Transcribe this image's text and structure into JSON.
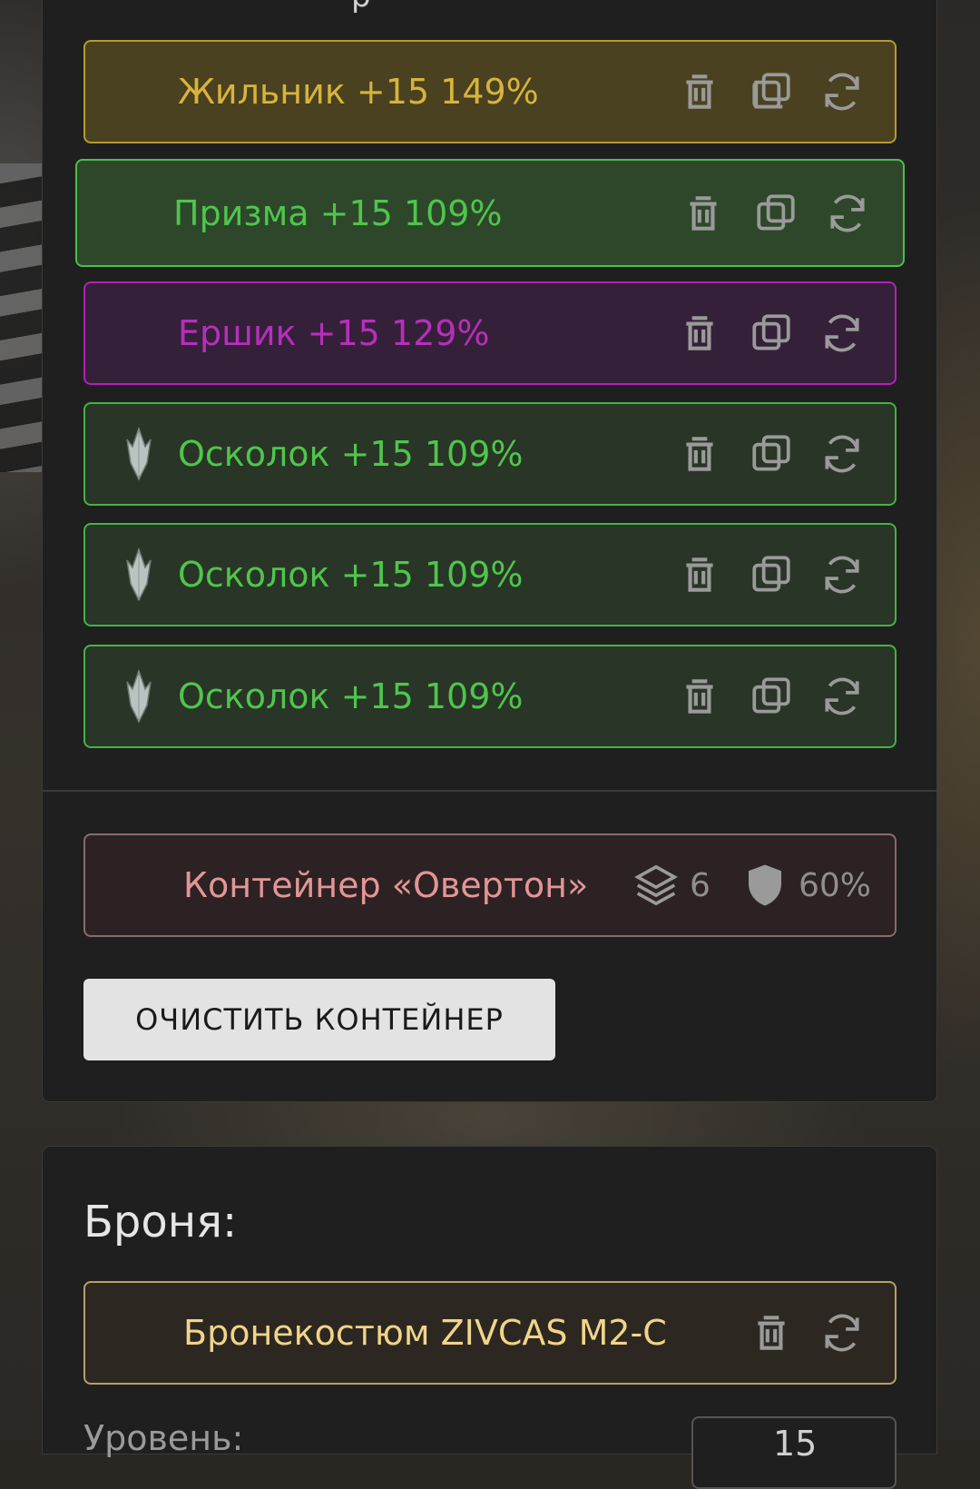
{
  "top_panel_partial_heading": "р",
  "modules": [
    {
      "label": "Жильник +15 149%",
      "color": "yellow",
      "has_gem": false
    },
    {
      "label": "Призма +15 109%",
      "color": "green",
      "has_gem": false
    },
    {
      "label": "Ершик +15 129%",
      "color": "purple",
      "has_gem": false
    },
    {
      "label": "Осколок +15 109%",
      "color": "green-dark",
      "has_gem": true
    },
    {
      "label": "Осколок +15 109%",
      "color": "green-dark",
      "has_gem": true
    },
    {
      "label": "Осколок +15 109%",
      "color": "green-dark",
      "has_gem": true
    }
  ],
  "container": {
    "label": "Контейнер «Овертон»",
    "slots": "6",
    "protection": "60%"
  },
  "clear_button_label": "ОЧИСТИТЬ КОНТЕЙНЕР",
  "armor": {
    "title": "Броня:",
    "item_label": "Бронекостюм ZIVCAS M2-C",
    "level_label": "Уровень:",
    "level_value": "15"
  },
  "icons": {
    "delete": "trash-icon",
    "copy": "copy-icon",
    "swap": "refresh-icon",
    "slots": "layers-icon",
    "protection": "shield-icon",
    "gem": "crystal-icon"
  },
  "colors": {
    "legendary": "#d8b33c",
    "rare": "#4fc54c",
    "epic": "#b62fbb",
    "container": "#e39595",
    "armor": "#f1d48a"
  }
}
